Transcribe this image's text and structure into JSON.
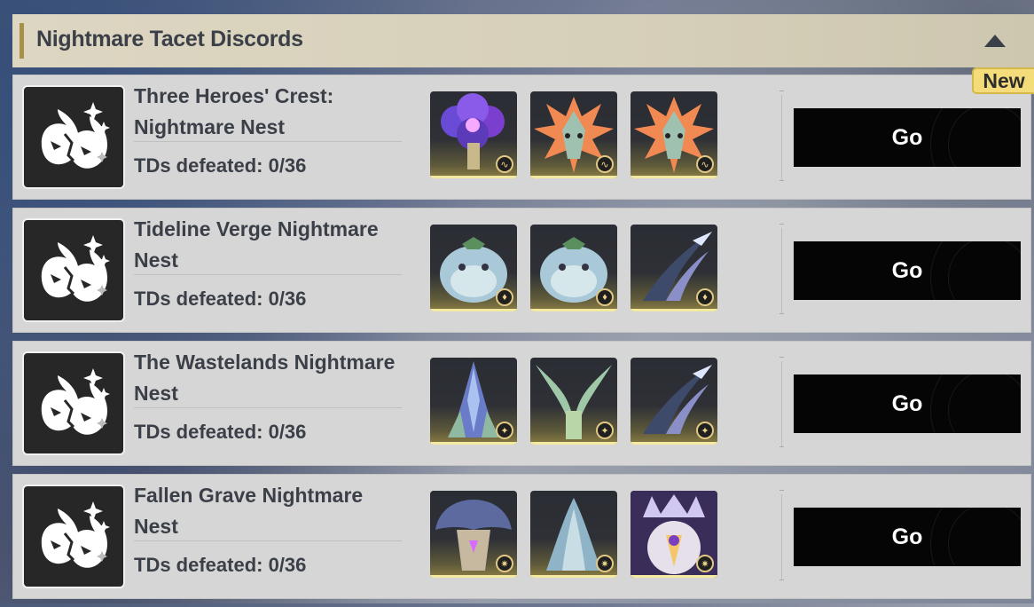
{
  "section": {
    "title": "Nightmare Tacet Discords",
    "toggle_icon": "triangle-up-icon",
    "badge": "New"
  },
  "colors": {
    "header_bg": "#ddd6c2",
    "accent_bar": "#a88f4a",
    "card_bg": "#d6d6d6",
    "button_bg": "#050505",
    "badge_bg": "#f5dc7a"
  },
  "nests": [
    {
      "name": "Three Heroes' Crest: Nightmare Nest",
      "progress": "TDs defeated: 0/36",
      "button": "Go",
      "enemies": [
        {
          "icon": "purple-flower-monster-icon",
          "element": "aero-element-icon"
        },
        {
          "icon": "spiked-dragon-monster-icon",
          "element": "aero-element-icon"
        },
        {
          "icon": "spiked-dragon-monster-icon",
          "element": "aero-element-icon"
        }
      ]
    },
    {
      "name": "Tideline Verge Nightmare Nest",
      "progress": "TDs defeated: 0/36",
      "button": "Go",
      "enemies": [
        {
          "icon": "pufferfish-monster-icon",
          "element": "fusion-element-icon"
        },
        {
          "icon": "pufferfish-monster-icon",
          "element": "fusion-element-icon"
        },
        {
          "icon": "scythe-monster-icon",
          "element": "fusion-element-icon"
        }
      ]
    },
    {
      "name": "The Wastelands Nightmare Nest",
      "progress": "TDs defeated: 0/36",
      "button": "Go",
      "enemies": [
        {
          "icon": "crystal-spire-monster-icon",
          "element": "spectro-element-icon"
        },
        {
          "icon": "horned-plant-monster-icon",
          "element": "spectro-element-icon"
        },
        {
          "icon": "scythe-monster-icon",
          "element": "spectro-element-icon"
        }
      ]
    },
    {
      "name": "Fallen Grave Nightmare Nest",
      "progress": "TDs defeated: 0/36",
      "button": "Go",
      "enemies": [
        {
          "icon": "mushroom-cap-monster-icon",
          "element": "havoc-element-icon"
        },
        {
          "icon": "hooded-spire-monster-icon",
          "element": "havoc-element-icon"
        },
        {
          "icon": "crowned-boss-monster-icon",
          "element": "havoc-element-icon"
        }
      ]
    }
  ]
}
